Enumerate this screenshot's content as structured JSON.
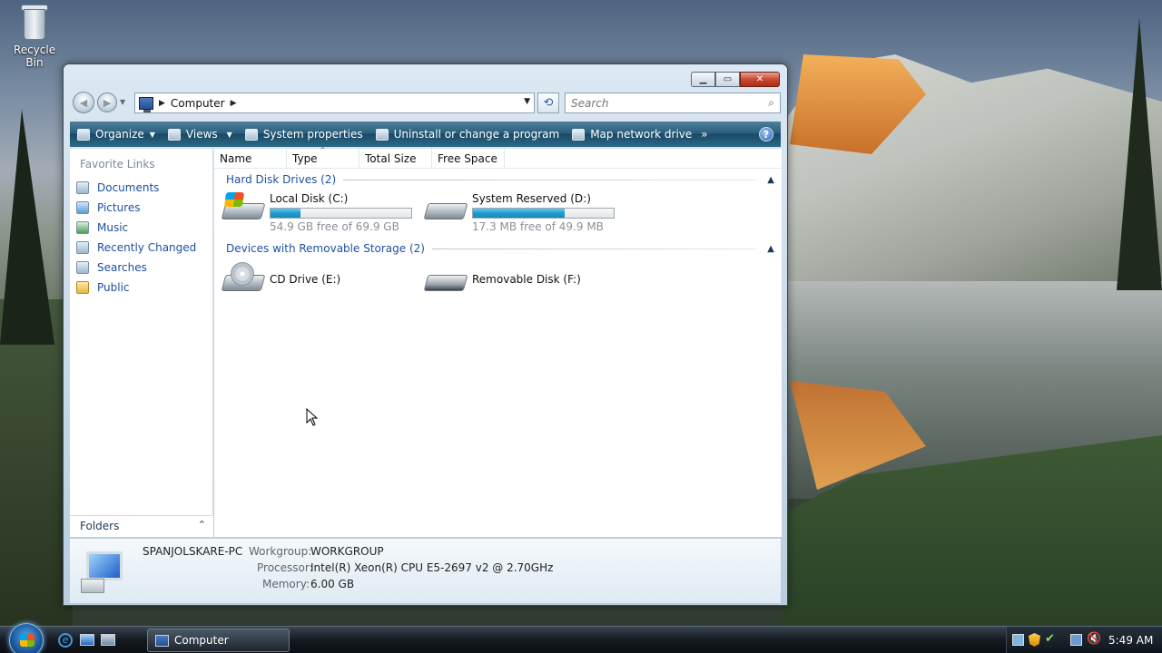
{
  "desktop": {
    "icons": [
      {
        "label": "Recycle Bin",
        "icon": "recycle-bin-icon"
      }
    ]
  },
  "window": {
    "caption_buttons": {
      "minimize": "minimize",
      "maximize": "maximize",
      "close": "close"
    },
    "address": {
      "root": "Computer"
    },
    "search": {
      "placeholder": "Search"
    },
    "toolbar": {
      "organize": "Organize",
      "views": "Views",
      "system_properties": "System properties",
      "uninstall": "Uninstall or change a program",
      "map_drive": "Map network drive",
      "more": "»",
      "help": "?"
    },
    "nav": {
      "favorite_title": "Favorite Links",
      "links": [
        {
          "label": "Documents",
          "icon": "documents-icon"
        },
        {
          "label": "Pictures",
          "icon": "pictures-icon"
        },
        {
          "label": "Music",
          "icon": "music-icon"
        },
        {
          "label": "Recently Changed",
          "icon": "recently-changed-icon"
        },
        {
          "label": "Searches",
          "icon": "searches-icon"
        },
        {
          "label": "Public",
          "icon": "public-folder-icon"
        }
      ],
      "folders": "Folders"
    },
    "columns": [
      "Name",
      "Type",
      "Total Size",
      "Free Space"
    ],
    "groups": {
      "hard_disks": "Hard Disk Drives (2)",
      "removable": "Devices with Removable Storage (2)"
    },
    "drives": [
      {
        "name": "Local Disk (C:)",
        "free": "54.9 GB free of 69.9 GB",
        "used_fraction": 0.21
      },
      {
        "name": "System Reserved (D:)",
        "free": "17.3 MB free of 49.9 MB",
        "used_fraction": 0.65
      },
      {
        "name": "CD Drive (E:)"
      },
      {
        "name": "Removable Disk (F:)"
      }
    ],
    "details": {
      "computer_name": "SPANJOLSKARE-PC",
      "workgroup_label": "Workgroup:",
      "workgroup": "WORKGROUP",
      "processor_label": "Processor:",
      "processor": "Intel(R) Xeon(R) CPU E5-2697 v2 @ 2.70GHz",
      "memory_label": "Memory:",
      "memory": "6.00 GB"
    }
  },
  "taskbar": {
    "task": "Computer",
    "clock": "5:49 AM"
  }
}
